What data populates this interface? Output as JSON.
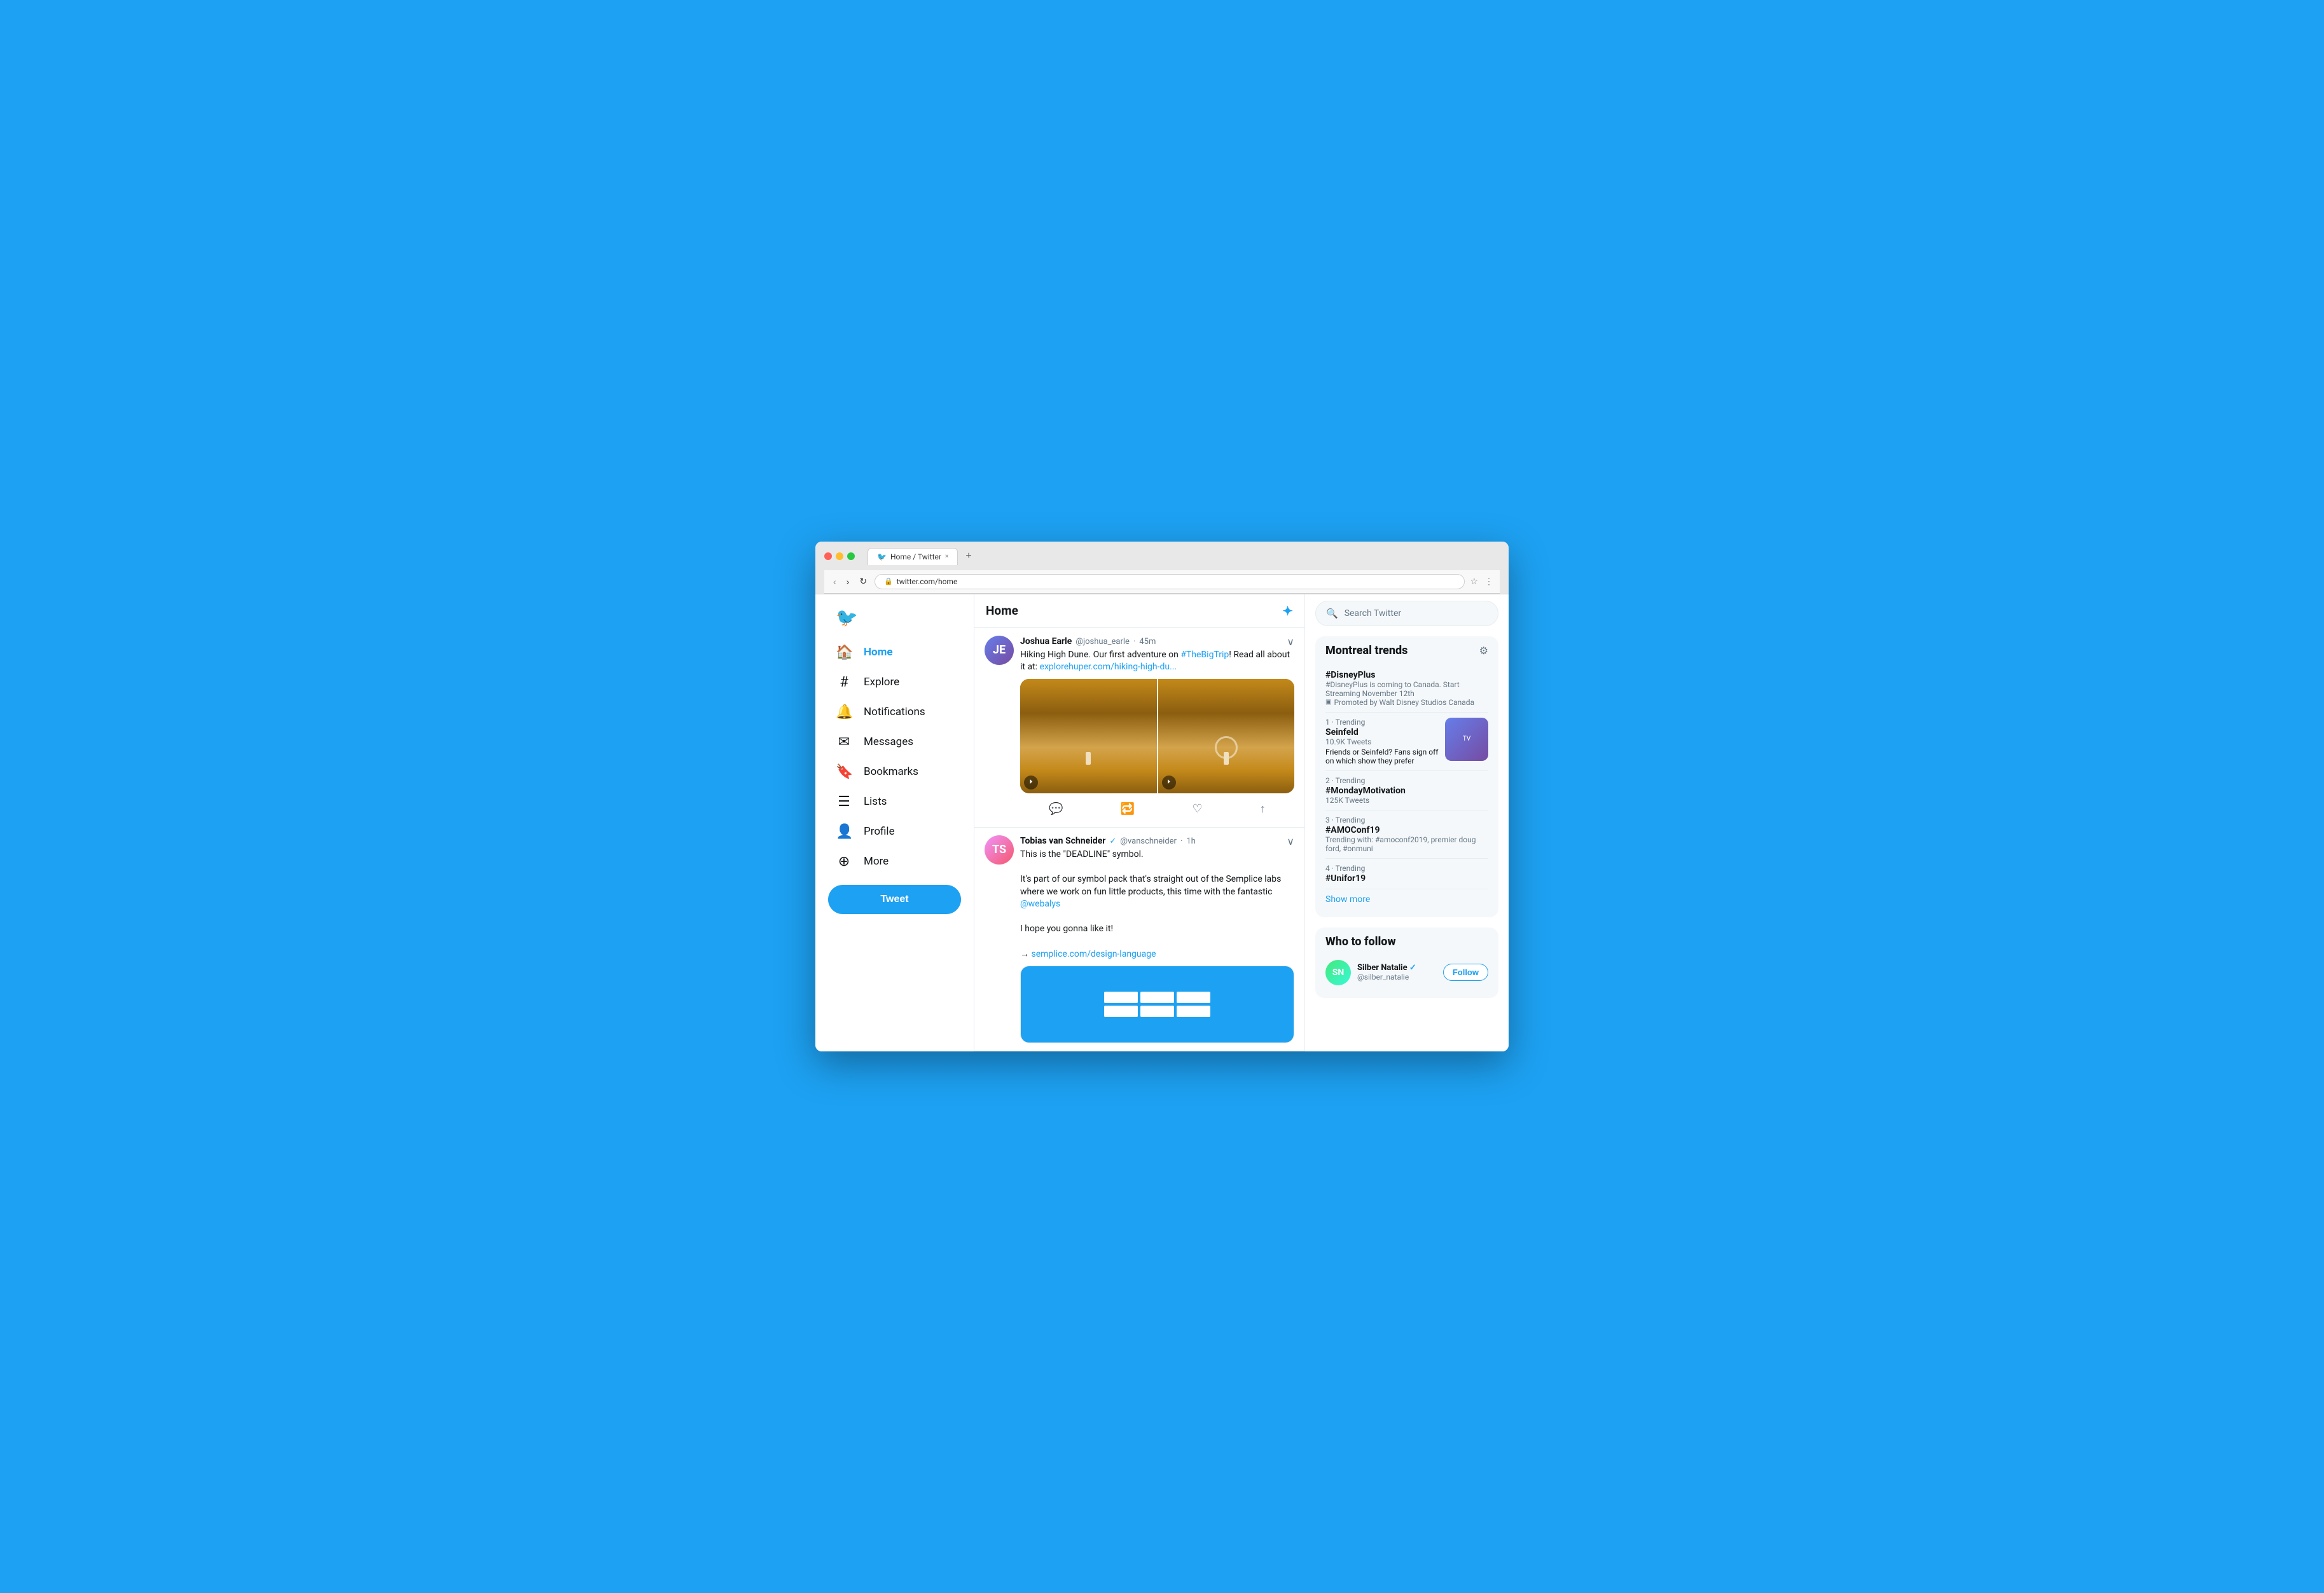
{
  "browser": {
    "tab_title": "Home / Twitter",
    "tab_close": "×",
    "tab_new": "+",
    "nav_back": "‹",
    "nav_forward": "›",
    "nav_refresh": "↻",
    "url": "twitter.com/home",
    "address_icons": [
      "🔒",
      "☆",
      "⋮"
    ]
  },
  "sidebar": {
    "logo_label": "Twitter Bird",
    "nav_items": [
      {
        "id": "home",
        "label": "Home",
        "icon": "🏠",
        "active": true
      },
      {
        "id": "explore",
        "label": "Explore",
        "icon": "#",
        "active": false
      },
      {
        "id": "notifications",
        "label": "Notifications",
        "icon": "🔔",
        "active": false
      },
      {
        "id": "messages",
        "label": "Messages",
        "icon": "✉",
        "active": false
      },
      {
        "id": "bookmarks",
        "label": "Bookmarks",
        "icon": "🔖",
        "active": false
      },
      {
        "id": "lists",
        "label": "Lists",
        "icon": "☰",
        "active": false
      },
      {
        "id": "profile",
        "label": "Profile",
        "icon": "👤",
        "active": false
      },
      {
        "id": "more",
        "label": "More",
        "icon": "⊕",
        "active": false
      }
    ],
    "tweet_button_label": "Tweet"
  },
  "feed": {
    "header_title": "Home",
    "sparkle_icon": "✦",
    "tweets": [
      {
        "id": "tweet1",
        "avatar_initials": "JE",
        "avatar_style": "joshua",
        "author_name": "Joshua Earle",
        "author_handle": "@joshua_earle",
        "time_ago": "45m",
        "verified": false,
        "text": "Hiking High Dune. Our first adventure on #TheBigTrip! Read all about it at: explorehuper.com/hiking-high-du...",
        "has_images": true,
        "link_text": "explorehuper.com/hiking-high-du...",
        "actions": {
          "comment": "💬",
          "retweet": "🔁",
          "like": "♡",
          "share": "↑"
        }
      },
      {
        "id": "tweet2",
        "avatar_initials": "TS",
        "avatar_style": "tobias",
        "author_name": "Tobias van Schneider",
        "author_handle": "@vanschneider",
        "time_ago": "1h",
        "verified": true,
        "text_line1": "This is the \"DEADLINE\" symbol.",
        "text_line2": "It's part of our symbol pack that's straight out of the Semplice labs where we work on fun little products, this time with the fantastic @webalys",
        "text_line3": "I hope you gonna like it!",
        "text_line4": "→ semplice.com/design-language",
        "link_text": "semplice.com/design-language",
        "has_card": true
      }
    ]
  },
  "right_sidebar": {
    "search_placeholder": "Search Twitter",
    "trends_section": {
      "title": "Montreal trends",
      "settings_icon": "⚙",
      "items": [
        {
          "type": "promoted",
          "name": "#DisneyPlus",
          "description": "#DisneyPlus is coming to Canada. Start Streaming November 12th",
          "promoted_by": "Promoted by Walt Disney Studios Canada"
        },
        {
          "type": "trending",
          "rank": "1",
          "category": "Trending",
          "name": "Seinfeld",
          "count": "10.9K Tweets",
          "has_thumb": true,
          "thumb_category": "Television",
          "thumb_sub": "Friends or Seinfeld? Fans sign off on which show they prefer"
        },
        {
          "type": "trending",
          "rank": "2",
          "category": "Trending",
          "name": "#MondayMotivation",
          "count": "125K Tweets"
        },
        {
          "type": "trending",
          "rank": "3",
          "category": "Trending",
          "name": "#AMOConf19",
          "count": "",
          "context": "Trending with: #amoconf2019, premier doug ford, #onmuni"
        },
        {
          "type": "trending",
          "rank": "4",
          "category": "Trending",
          "name": "#Unifor19"
        }
      ],
      "show_more_label": "Show more"
    },
    "who_to_follow": {
      "title": "Who to follow",
      "follow_button_label": "Follow",
      "items": [
        {
          "initials": "SN",
          "name": "Silber Natalie",
          "handle": "@silber_natalie",
          "verified": true
        }
      ]
    }
  }
}
